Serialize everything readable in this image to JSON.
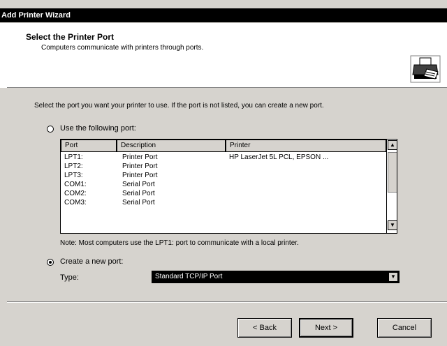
{
  "window": {
    "title": "Add Printer Wizard"
  },
  "header": {
    "title": "Select the Printer Port",
    "subtitle": "Computers communicate with printers through ports."
  },
  "instructions": "Select the port you want your printer to use. If the port is not listed, you can create a new port.",
  "radio_existing": {
    "label": "Use the following port:",
    "selected": false
  },
  "port_list": {
    "columns": [
      "Port",
      "Description",
      "Printer"
    ],
    "rows": [
      {
        "port": "LPT1:",
        "description": "Printer Port",
        "printer": "HP LaserJet 5L PCL, EPSON ..."
      },
      {
        "port": "LPT2:",
        "description": "Printer Port",
        "printer": ""
      },
      {
        "port": "LPT3:",
        "description": "Printer Port",
        "printer": ""
      },
      {
        "port": "COM1:",
        "description": "Serial Port",
        "printer": ""
      },
      {
        "port": "COM2:",
        "description": "Serial Port",
        "printer": ""
      },
      {
        "port": "COM3:",
        "description": "Serial Port",
        "printer": ""
      }
    ]
  },
  "note": "Note: Most computers use the LPT1: port to communicate with a local printer.",
  "radio_new": {
    "label": "Create a new port:",
    "selected": true
  },
  "type": {
    "label": "Type:",
    "value": "Standard TCP/IP Port"
  },
  "buttons": {
    "back": "< Back",
    "next": "Next >",
    "cancel": "Cancel"
  }
}
